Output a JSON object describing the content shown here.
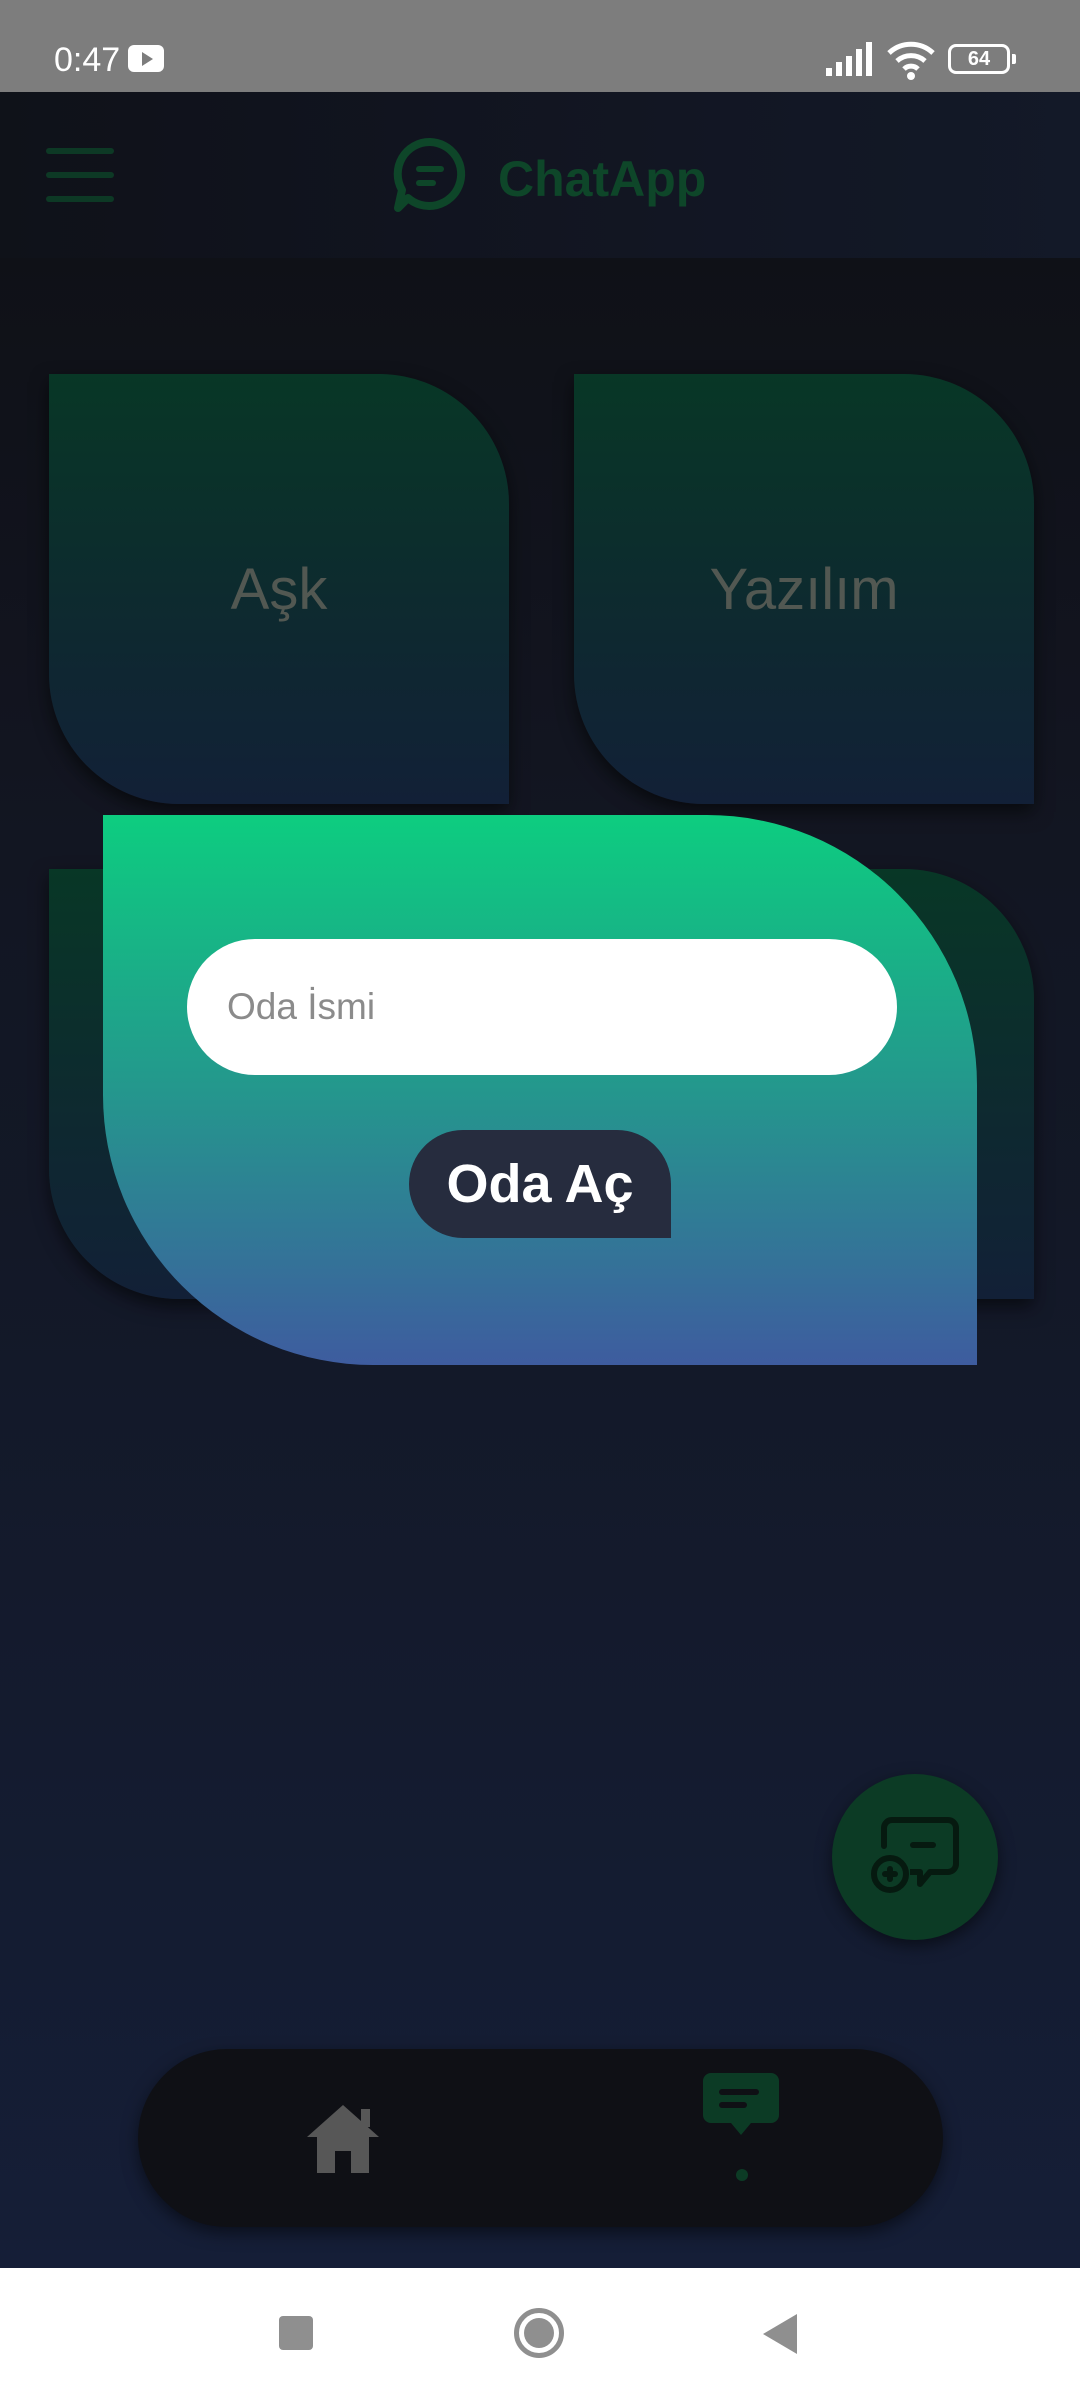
{
  "status_bar": {
    "time": "0:47",
    "battery": "64",
    "notification_icons": [
      "youtube-icon"
    ],
    "system_icons": [
      "signal-icon",
      "wifi-icon",
      "battery-icon"
    ]
  },
  "header": {
    "title": "ChatApp",
    "menu_icon": "hamburger-menu-icon",
    "logo_icon": "chat-bubble-icon"
  },
  "rooms": [
    {
      "label": "Aşk"
    },
    {
      "label": "Yazılım"
    },
    {
      "label": ""
    },
    {
      "label": ""
    }
  ],
  "dialog": {
    "input_value": "",
    "input_placeholder": "Oda İsmi",
    "submit_label": "Oda Aç"
  },
  "fab": {
    "icon": "add-chat-icon"
  },
  "bottom_nav": {
    "items": [
      {
        "icon": "home-icon",
        "active": false
      },
      {
        "icon": "chat-icon",
        "active": true
      }
    ]
  },
  "system_nav": {
    "items": [
      "recents-button",
      "home-button",
      "back-button"
    ]
  },
  "colors": {
    "accent_green": "#0c3b25",
    "dialog_gradient_top": "#0dcd80",
    "dialog_gradient_bottom": "#3e5c9f",
    "background": "#161a2a",
    "button_bg": "#262c3e"
  }
}
